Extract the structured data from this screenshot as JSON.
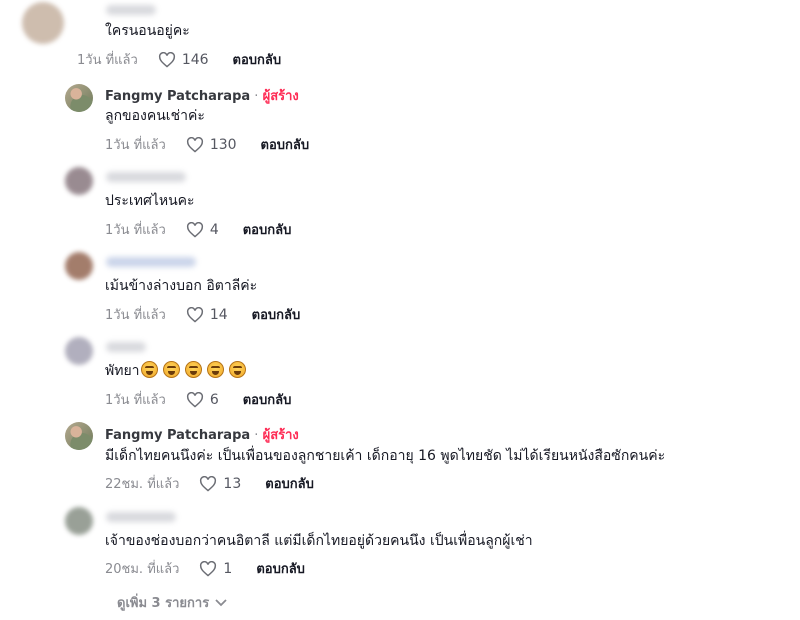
{
  "comments": [
    {
      "author": "",
      "text": "ใครนอนอยู่คะ",
      "time": "1วัน ที่แล้ว",
      "likes": "146",
      "reply": "ตอบกลับ"
    },
    {
      "author": "Fangmy Patcharapa",
      "separator": " · ",
      "badge": "ผู้สร้าง",
      "text": "ลูกของคนเช่าค่ะ",
      "time": "1วัน ที่แล้ว",
      "likes": "130",
      "reply": "ตอบกลับ"
    },
    {
      "author": "",
      "text": "ประเทศไหนคะ",
      "time": "1วัน ที่แล้ว",
      "likes": "4",
      "reply": "ตอบกลับ"
    },
    {
      "author": "",
      "text": "เม้นข้างล่างบอก อิตาลีค่ะ",
      "time": "1วัน ที่แล้ว",
      "likes": "14",
      "reply": "ตอบกลับ"
    },
    {
      "author": "",
      "text": "พัทยา",
      "emoji_count": 5,
      "emoji": "laughing-face-emoji",
      "time": "1วัน ที่แล้ว",
      "likes": "6",
      "reply": "ตอบกลับ"
    },
    {
      "author": "Fangmy Patcharapa",
      "separator": " · ",
      "badge": "ผู้สร้าง",
      "text": "มีเด็กไทยคนนึงค่ะ เป็นเพื่อนของลูกชายเค้า เด็กอายุ 16 พูดไทยชัด ไม่ได้เรียนหนังสือซักคนค่ะ",
      "time": "22ชม. ที่แล้ว",
      "likes": "13",
      "reply": "ตอบกลับ"
    },
    {
      "author": "",
      "text": "เจ้าของช่องบอกว่าคนอิตาลี แต่มีเด็กไทยอยู่ด้วยคนนึง เป็นเพื่อนลูกผู้เช่า",
      "time": "20ชม. ที่แล้ว",
      "likes": "1",
      "reply": "ตอบกลับ"
    }
  ],
  "view_more": "ดูเพิ่ม 3 รายการ",
  "colors": {
    "creator_badge": "#fe2c55",
    "text": "#161823",
    "muted": "#8a8b91"
  },
  "icons": {
    "like": "heart-outline-icon",
    "expand": "chevron-down-icon"
  }
}
